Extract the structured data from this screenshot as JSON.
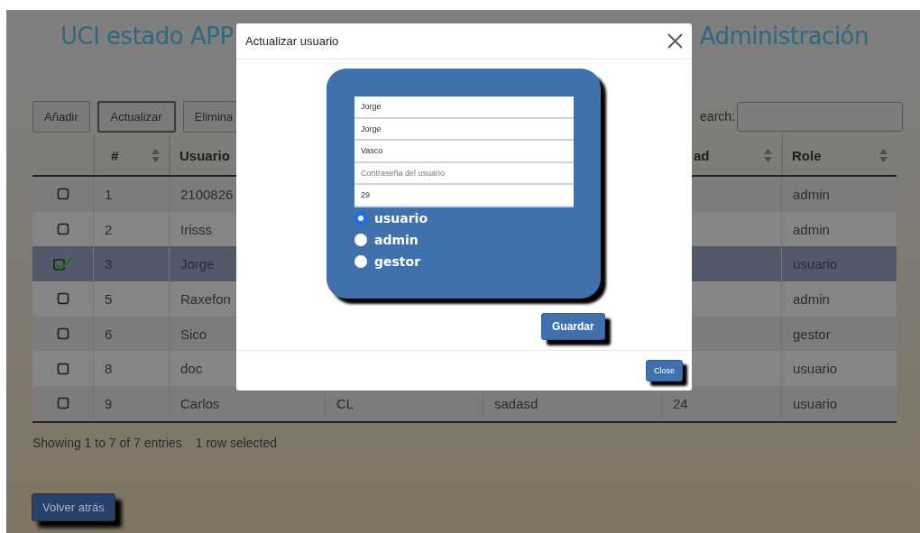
{
  "header": {
    "title": "UCI estado APP",
    "section": "Administración"
  },
  "toolbar": {
    "buttons": [
      {
        "label": "Añadir",
        "selected": false
      },
      {
        "label": "Actualizar",
        "selected": true
      },
      {
        "label": "Elimina",
        "selected": false
      }
    ],
    "search": {
      "label": "earch:"
    }
  },
  "table": {
    "columns": [
      {
        "kind": "select"
      },
      {
        "kind": "text",
        "label": "#",
        "sortable": true
      },
      {
        "kind": "text",
        "label": "Usuario"
      },
      {
        "kind": "text"
      },
      {
        "kind": "text"
      },
      {
        "kind": "text",
        "label": "ad",
        "sortable": true
      },
      {
        "kind": "text",
        "label": "Role",
        "sortable": true
      }
    ],
    "rows": [
      {
        "selected": false,
        "cells": {
          "number": "1",
          "usuario": "2100826",
          "role": "admin"
        }
      },
      {
        "selected": false,
        "cells": {
          "number": "2",
          "usuario": "Irisss",
          "role": "admin"
        }
      },
      {
        "selected": true,
        "cells": {
          "number": "3",
          "usuario": "Jorge",
          "role": "usuario"
        }
      },
      {
        "selected": false,
        "cells": {
          "number": "5",
          "usuario": "Raxefon",
          "role": "admin"
        }
      },
      {
        "selected": false,
        "cells": {
          "number": "6",
          "usuario": "Sico",
          "role": "gestor"
        }
      },
      {
        "selected": false,
        "cells": {
          "number": "8",
          "usuario": "doc",
          "role": "usuario"
        }
      },
      {
        "selected": false,
        "cells": {
          "number": "9",
          "usuario": "Carlos",
          "column_4": "CL",
          "column_5": "sadasd",
          "column_6": "24",
          "role": "usuario"
        }
      }
    ]
  },
  "status": {
    "info": "Showing 1 to 7 of 7 entries",
    "selection": "1 row selected"
  },
  "back_button": "Volver atrás",
  "dialog": {
    "title": "Actualizar usuario",
    "fields": [
      {
        "value": "Jorge"
      },
      {
        "value": "Jorge"
      },
      {
        "value": "Vasco"
      },
      {
        "placeholder": "Contraseña del usuario"
      },
      {
        "value": "29"
      }
    ],
    "roles": [
      {
        "label": "usuario",
        "selected": true
      },
      {
        "label": "admin",
        "selected": false
      },
      {
        "label": "gestor",
        "selected": false
      }
    ],
    "save_button": "Guardar",
    "close_button": "Close"
  }
}
